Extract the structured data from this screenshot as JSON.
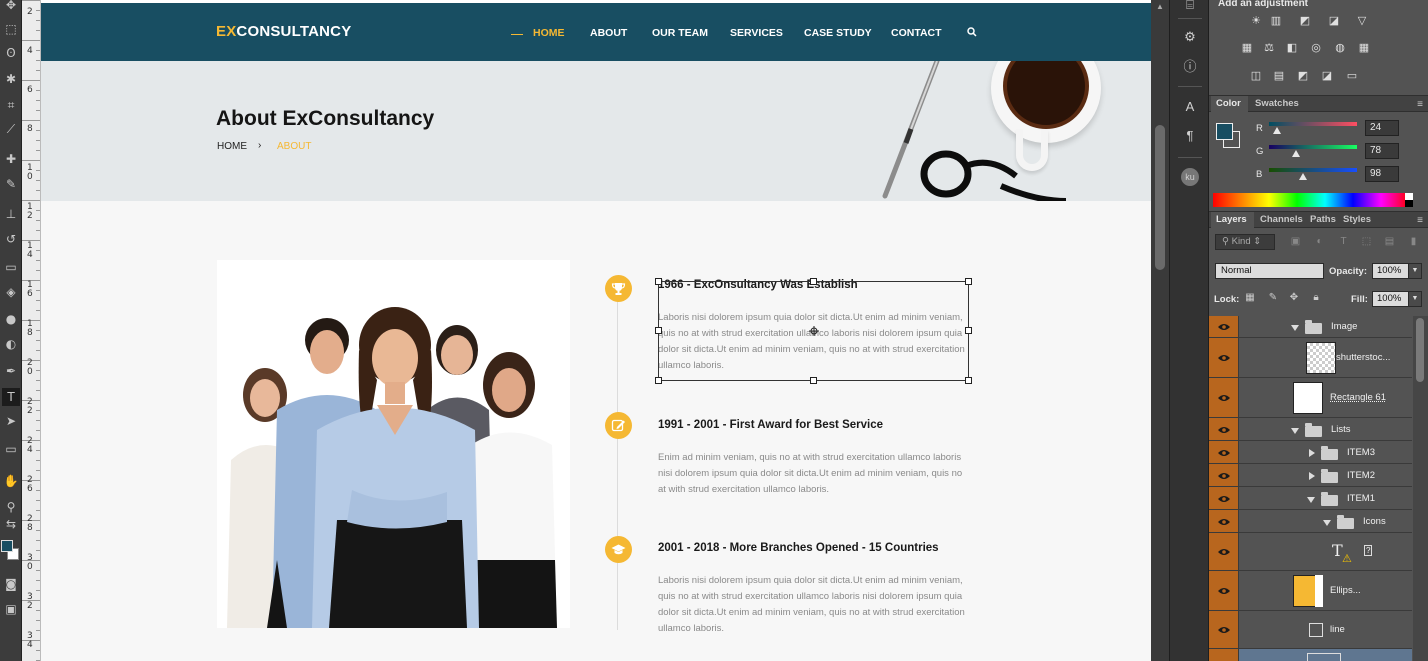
{
  "tools": {
    "names": [
      "move-tool",
      "marquee-tool",
      "lasso-tool",
      "magic-wand-tool",
      "crop-tool",
      "eyedropper-tool",
      "healing-brush-tool",
      "brush-tool",
      "clone-stamp-tool",
      "history-brush-tool",
      "eraser-tool",
      "paint-bucket-tool",
      "blur-tool",
      "dodge-tool",
      "pen-tool",
      "type-tool",
      "path-selection-tool",
      "rectangle-tool",
      "hand-tool",
      "zoom-tool",
      "switch-colors-icon",
      "quick-mask-icon",
      "screen-mode-icon"
    ],
    "glyphs": [
      "✥",
      "⬚",
      "ʘ",
      "✱",
      "⌗",
      "⟋",
      "✚",
      "✎",
      "⊥",
      "↺",
      "▭",
      "◈",
      "●",
      "◐",
      "✒",
      "T",
      "➤",
      "▭",
      "✋",
      "⚲",
      "⇆",
      "◙",
      "▣"
    ],
    "active_index": 15
  },
  "ruler": {
    "labels": [
      "2",
      "4",
      "6",
      "8",
      "1\n0",
      "1\n2",
      "1\n4",
      "1\n6",
      "1\n8",
      "2\n0",
      "2\n2",
      "2\n4",
      "2\n6",
      "2\n8",
      "3\n0",
      "3\n2",
      "3\n4"
    ]
  },
  "site": {
    "logo_ex": "EX",
    "logo_rest": "CONSULTANCY",
    "nav": [
      "HOME",
      "ABOUT",
      "OUR TEAM",
      "SERVICES",
      "CASE STUDY",
      "CONTACT"
    ],
    "active_nav": "HOME",
    "hero_title": "About ExConsultancy",
    "crumb_home": "HOME",
    "crumb_sep": "›",
    "crumb_current": "ABOUT",
    "timeline": [
      {
        "title": "1966 - ExcOnsultancy Was Establish",
        "text": "Laboris nisi dolorem ipsum quia dolor sit dicta.Ut enim ad minim veniam, quis no at with strud exercitation ullamco laboris nisi dolorem ipsum quia dolor sit dicta.Ut enim ad minim veniam, quis no at with strud exercitation ullamco laboris.",
        "icon": "trophy-icon"
      },
      {
        "title": "1991 - 2001 - First Award for Best Service",
        "text": "Enim ad minim veniam, quis no at with strud exercitation ullamco laboris nisi dolorem ipsum quia dolor sit dicta.Ut enim ad minim veniam, quis no at with strud exercitation ullamco laboris.",
        "icon": "edit-icon"
      },
      {
        "title": "2001 - 2018 - More Branches Opened - 15 Countries",
        "text": "Laboris nisi dolorem ipsum quia dolor sit dicta.Ut enim ad minim veniam, quis no at with strud exercitation ullamco laboris nisi dolorem ipsum quia dolor sit dicta.Ut enim ad minim veniam, quis no at with strud exercitation ullamco laboris.",
        "icon": "graduation-cap-icon"
      }
    ],
    "colors": {
      "header": "#184e62",
      "accent": "#f5b833"
    }
  },
  "panels": {
    "adjustments_title": "Add an adjustment",
    "adjustment_icons": [
      "brightness-contrast-icon",
      "levels-icon",
      "curves-icon",
      "exposure-icon",
      "vibrance-icon",
      "hue-saturation-icon",
      "color-balance-icon",
      "black-white-icon",
      "photo-filter-icon",
      "channel-mixer-icon",
      "color-lookup-icon",
      "invert-icon",
      "posterize-icon",
      "threshold-icon",
      "selective-color-icon",
      "gradient-map-icon"
    ],
    "adjustment_glyphs": [
      "☀",
      "▥",
      "◩",
      "◪",
      "▽",
      "▦",
      "⚖",
      "◧",
      "◎",
      "◍",
      "▦",
      "◫",
      "▤",
      "◩",
      "◪",
      "▭"
    ],
    "color_tabs": [
      "Color",
      "Swatches"
    ],
    "rgb": {
      "r_label": "R",
      "g_label": "G",
      "b_label": "B",
      "r": "24",
      "g": "78",
      "b": "98"
    },
    "layer_tabs": [
      "Layers",
      "Channels",
      "Paths",
      "Styles"
    ],
    "kind": "Kind",
    "blend_mode": "Normal",
    "opacity_label": "Opacity:",
    "opacity": "100%",
    "lock_label": "Lock:",
    "fill_label": "Fill:",
    "fill": "100%",
    "layers": [
      {
        "name": "Image",
        "type": "group",
        "indent": 1,
        "expanded": true
      },
      {
        "name": "shutterstoc...",
        "type": "image",
        "indent": 3
      },
      {
        "name": "Rectangle 61",
        "type": "shape",
        "indent": 2
      },
      {
        "name": "Lists",
        "type": "group",
        "indent": 1,
        "expanded": true
      },
      {
        "name": "ITEM3",
        "type": "group",
        "indent": 2,
        "expanded": false
      },
      {
        "name": "ITEM2",
        "type": "group",
        "indent": 2,
        "expanded": false
      },
      {
        "name": "ITEM1",
        "type": "group",
        "indent": 2,
        "expanded": true
      },
      {
        "name": "Icons",
        "type": "group",
        "indent": 3,
        "expanded": true
      },
      {
        "name": "",
        "type": "text",
        "indent": 4
      },
      {
        "name": "Ellips...",
        "type": "ellipse",
        "indent": 4
      },
      {
        "name": "line",
        "type": "shape-small",
        "indent": 4
      },
      {
        "name": "",
        "type": "selected",
        "indent": 4
      }
    ]
  }
}
